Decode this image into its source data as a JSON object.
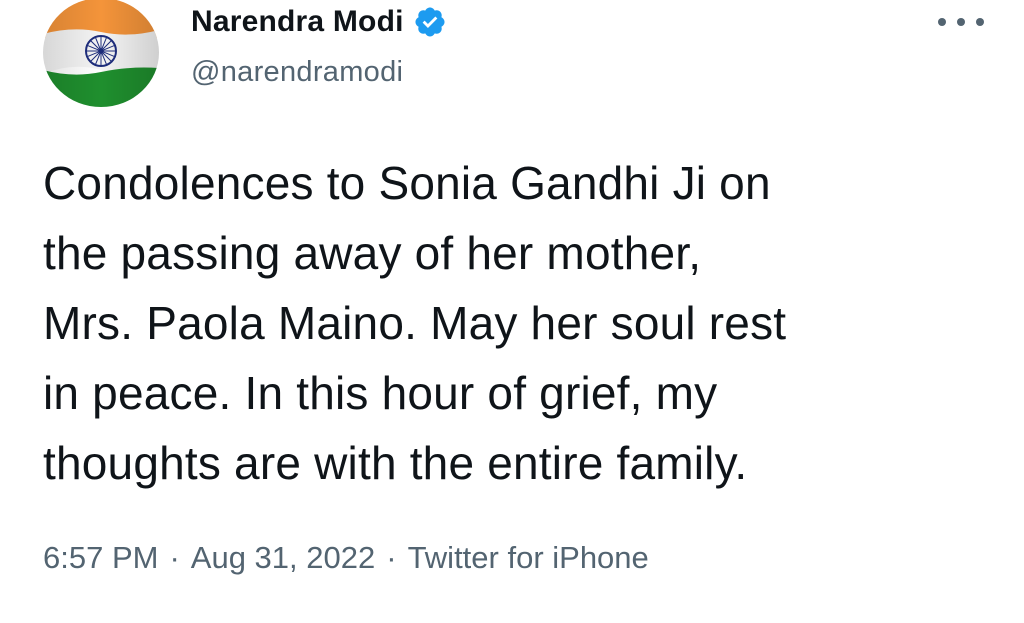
{
  "author": {
    "display_name": "Narendra Modi",
    "handle": "@narendramodi",
    "verified": true,
    "avatar": "india-flag-avatar"
  },
  "tweet": {
    "text": "Condolences to Sonia Gandhi Ji on\nthe passing away of her mother,\nMrs. Paola Maino. May her soul rest\nin peace. In this hour of grief, my\nthoughts are with the entire family."
  },
  "meta": {
    "time": "6:57 PM",
    "separator": "·",
    "date": "Aug 31, 2022",
    "source": "Twitter for iPhone"
  },
  "icons": {
    "more": "more-horizontal-icon",
    "verified": "verified-badge-icon"
  },
  "colors": {
    "verified_blue": "#1d9bf0",
    "secondary_text": "#536471",
    "primary_text": "#0f1419",
    "flag_saffron": "#f4943a",
    "flag_white": "#f4f4f4",
    "flag_green": "#1f8f2e",
    "chakra_navy": "#1d2c7a"
  }
}
